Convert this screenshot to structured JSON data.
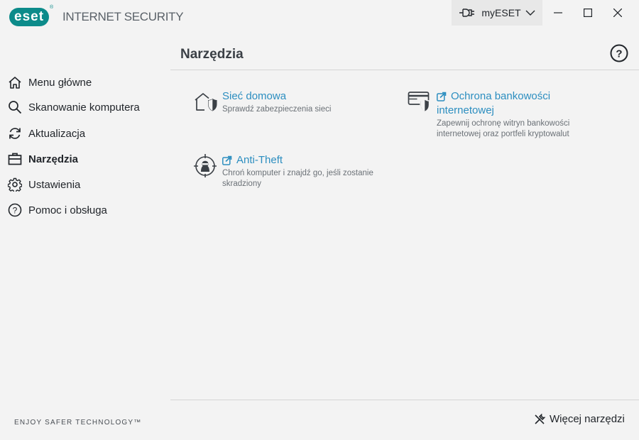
{
  "app": {
    "logo_text": "eset",
    "product_name": "INTERNET SECURITY",
    "account_label": "myESET"
  },
  "sidebar": {
    "items": [
      {
        "label": "Menu główne",
        "icon": "home-icon"
      },
      {
        "label": "Skanowanie komputera",
        "icon": "search-icon"
      },
      {
        "label": "Aktualizacja",
        "icon": "refresh-icon"
      },
      {
        "label": "Narzędzia",
        "icon": "briefcase-icon",
        "active": true
      },
      {
        "label": "Ustawienia",
        "icon": "gear-icon"
      },
      {
        "label": "Pomoc i obsługa",
        "icon": "help-icon"
      }
    ],
    "tagline": "ENJOY SAFER TECHNOLOGY™"
  },
  "main": {
    "title": "Narzędzia",
    "tools": [
      {
        "title": "Sieć domowa",
        "description": "Sprawdź zabezpieczenia sieci",
        "icon": "home-shield-icon",
        "external": false
      },
      {
        "title_line1": "Ochrona bankowości",
        "title_line2": "internetowej",
        "description_line1": "Zapewnij ochronę witryn bankowości",
        "description_line2": "internetowej oraz portfeli kryptowalut",
        "icon": "bank-shield-icon",
        "external": true
      },
      {
        "title": "Anti-Theft",
        "description_line1": "Chroń komputer i znajdź go, jeśli zostanie",
        "description_line2": "skradziony",
        "icon": "thief-target-icon",
        "external": true
      }
    ],
    "more_tools_label": "Więcej narzędzi"
  },
  "colors": {
    "brand": "#0c8b8a",
    "link": "#2c8ec0",
    "background": "#f3f3f3"
  }
}
